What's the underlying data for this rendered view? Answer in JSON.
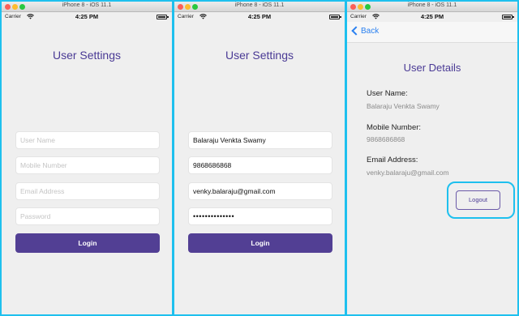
{
  "window_title": "iPhone 8 - iOS 11.1",
  "status": {
    "carrier": "Carrier",
    "time": "4:25 PM"
  },
  "screen1": {
    "title": "User Settings",
    "fields": [
      {
        "placeholder": "User Name"
      },
      {
        "placeholder": "Mobile Number"
      },
      {
        "placeholder": "Email Address"
      },
      {
        "placeholder": "Password"
      }
    ],
    "login_label": "Login"
  },
  "screen2": {
    "title": "User Settings",
    "fields": [
      {
        "value": "Balaraju Venkta Swamy"
      },
      {
        "value": "9868686868"
      },
      {
        "value": "venky.balaraju@gmail.com"
      },
      {
        "value": "••••••••••••••"
      }
    ],
    "login_label": "Login"
  },
  "screen3": {
    "back_label": "Back",
    "title": "User Details",
    "user_name_label": "User Name:",
    "user_name_value": "Balaraju Venkta Swamy",
    "mobile_label": "Mobile Number:",
    "mobile_value": "9868686868",
    "email_label": "Email Address:",
    "email_value": "venky.balaraju@gmail.com",
    "logout_label": "Logout"
  },
  "colors": {
    "accent": "#523f94",
    "highlight": "#1ec0ee",
    "link": "#2a80f0"
  }
}
